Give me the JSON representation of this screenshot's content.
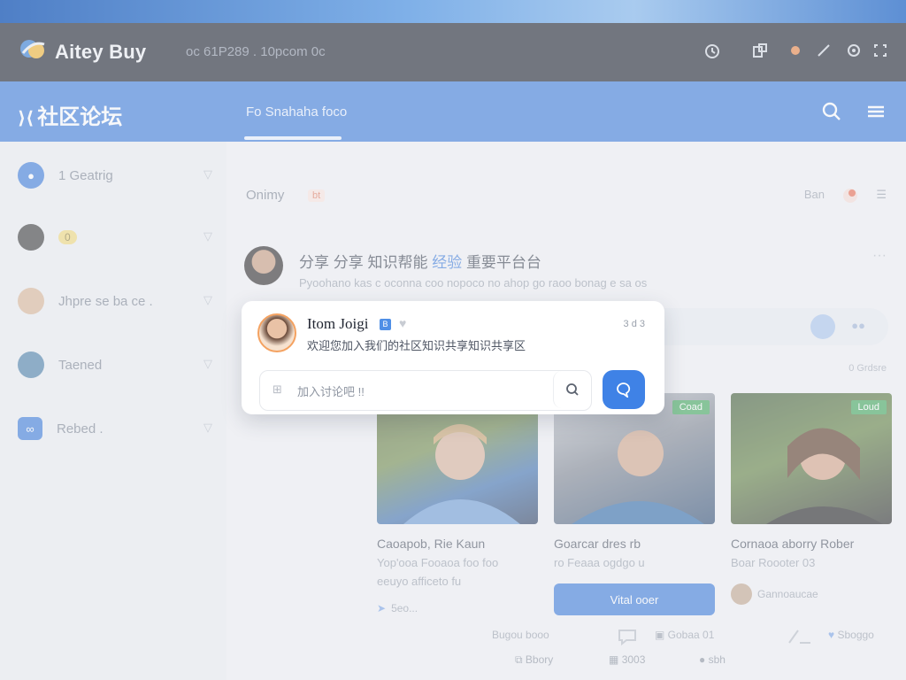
{
  "window": {
    "brand": "Aitey Buy",
    "url": "oc 61P289 . 10pcom 0c"
  },
  "header": {
    "forum_title": "社区论坛",
    "tab_active": "Fo Snahaha foco"
  },
  "sidebar": {
    "items": [
      {
        "label": "1 Geatrig",
        "icon": "chat-bubble-icon",
        "color": "#3b7ad9"
      },
      {
        "label": "",
        "badge": "0",
        "icon": "avatar",
        "color": "#3a3a3a"
      },
      {
        "label": "Jhpre se ba ce .",
        "icon": "avatar",
        "color": "#d9b596"
      },
      {
        "label": "Taened",
        "icon": "avatar",
        "color": "#4a7fa8"
      },
      {
        "label": "Rebed .",
        "icon": "link-icon",
        "color": "#3b7ad9"
      }
    ]
  },
  "feed": {
    "top_label": "Onimy",
    "top_badge": "bt",
    "top_right_label": "Ban",
    "post": {
      "title_prefix": "分享 分享",
      "title_mid": "知识帮能",
      "title_highlight": "经验",
      "title_suffix": "重要平台台",
      "subtitle": "Pyoohano kas c oconna coo nopoco no ahop go raoo bonag e sa os"
    },
    "small_right": "0 Grdsre",
    "cards": [
      {
        "title": "Caoapob, Rie Kaun",
        "line1": "Yop'ooa Fooaoa foo foo",
        "line2": "eeuyo afficeto fu",
        "meta": "5eo...",
        "tag": ""
      },
      {
        "title": "Goarcar dres rb",
        "line1": "ro Feaaa ogdgo u",
        "button": "Vital ooer",
        "tag": "Coad"
      },
      {
        "title": "Cornaoa aborry Rober",
        "line1": "Boar Roooter 03",
        "meta": "Gannoaucae",
        "tag": "Loud"
      }
    ],
    "bottom": {
      "a": "Bugou booo",
      "b": "Gobaa 01",
      "c": "Sboggo"
    }
  },
  "footer": {
    "a": "Bbory",
    "b": "3003",
    "c": "sbh"
  },
  "popup": {
    "name": "Itom Joigi",
    "time": "3 d 3",
    "description": "欢迎您加入我们的社区知识共享知识共享区",
    "input_placeholder": "加入讨论吧 !!"
  }
}
